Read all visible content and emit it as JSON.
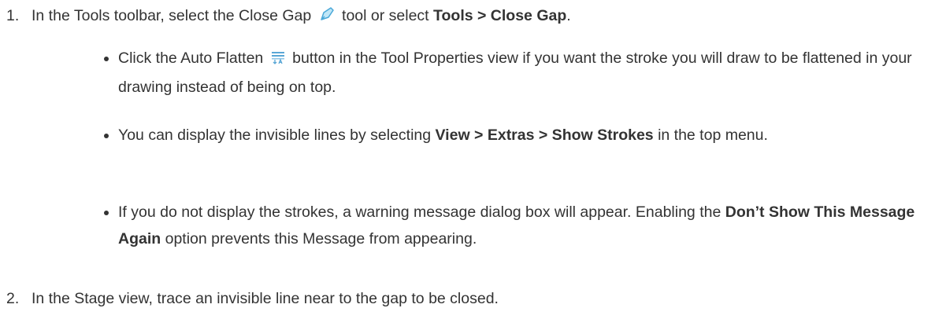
{
  "steps": [
    {
      "number": "1.",
      "text_before_icon": "In the Tools toolbar, select the Close Gap",
      "icon": "close-gap-tool-icon",
      "text_after_icon": "tool or select",
      "menu_path": "Tools > Close Gap",
      "text_end": "."
    },
    {
      "number": "2.",
      "text": "In the Stage view, trace an invisible line near to the gap to be closed."
    }
  ],
  "bullets": [
    {
      "text_before_icon": "Click the Auto Flatten",
      "icon": "auto-flatten-icon",
      "text_after_icon": "button in the Tool Properties view if you want the stroke you will draw to be flattened in your drawing instead of being on top."
    },
    {
      "text_before_bold": "You can display the invisible lines by selecting",
      "bold": "View > Extras > Show Strokes",
      "text_after_bold": "in the top menu."
    },
    {
      "text_before_bold": "If you do not display the strokes, a warning message dialog box will appear. Enabling the",
      "bold": "Don’t Show This Message Again",
      "text_after_bold": "option prevents this Message from appearing."
    }
  ],
  "colors": {
    "text": "#333333",
    "close_gap_icon_fill": "#bfe6f7",
    "close_gap_icon_stroke": "#4aa8d8",
    "auto_flatten_icon": "#5aa7d6"
  }
}
